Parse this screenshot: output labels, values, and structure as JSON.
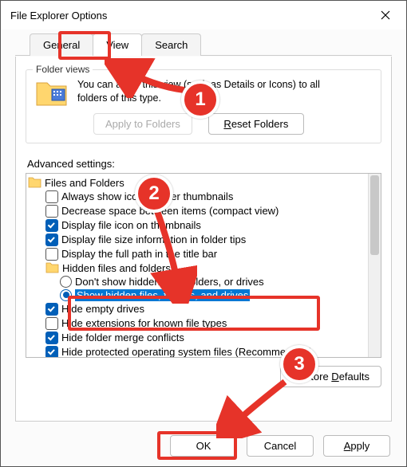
{
  "window": {
    "title": "File Explorer Options"
  },
  "tabs": {
    "general": "General",
    "view": "View",
    "search": "Search"
  },
  "folderViews": {
    "legend": "Folder views",
    "desc1": "You can apply this view (such as Details or Icons) to all",
    "desc2": "folders of this type.",
    "applyBtn": "Apply to Folders",
    "resetBtn": "Reset Folders"
  },
  "advanced": {
    "label": "Advanced settings:",
    "root": "Files and Folders",
    "items": {
      "i1": "Always show icons, never thumbnails",
      "i2": "Decrease space between items (compact view)",
      "i3": "Display file icon on thumbnails",
      "i4": "Display file size information in folder tips",
      "i5": "Display the full path in the title bar",
      "hidden": "Hidden files and folders",
      "r1": "Don't show hidden files, folders, or drives",
      "r2": "Show hidden files, folders, and drives",
      "i6": "Hide empty drives",
      "i7": "Hide extensions for known file types",
      "i8": "Hide folder merge conflicts",
      "i9": "Hide protected operating system files (Recommended)"
    },
    "restoreBtn": "Restore Defaults"
  },
  "footer": {
    "ok": "OK",
    "cancel": "Cancel",
    "apply": "Apply"
  },
  "annotations": {
    "n1": "1",
    "n2": "2",
    "n3": "3"
  }
}
